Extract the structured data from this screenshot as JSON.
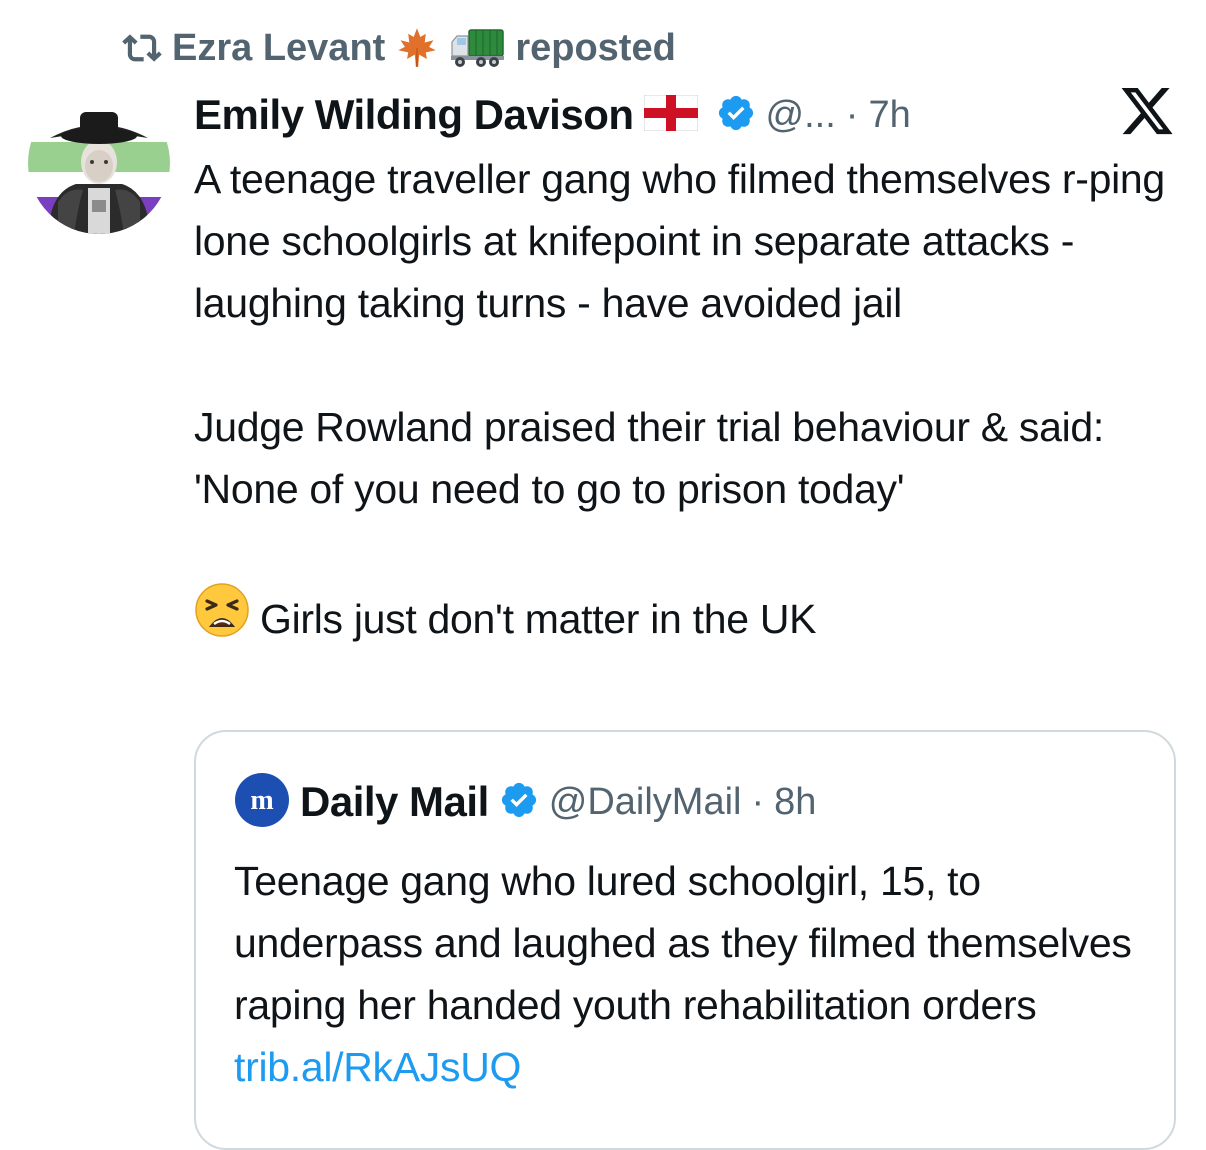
{
  "repost": {
    "user": "Ezra Levant",
    "action": "reposted",
    "icons": [
      "repost-icon",
      "maple-leaf-emoji",
      "truck-emoji"
    ]
  },
  "post": {
    "display_name": "Emily Wilding Davison",
    "name_emoji": "england-flag-emoji",
    "handle": "@...",
    "separator": "·",
    "time": "7h",
    "paragraphs": [
      "A teenage traveller gang who filmed themselves r-ping lone schoolgirls at knifepoint in separate attacks - laughing taking turns - have avoided jail",
      "Judge Rowland praised their trial behaviour & said: 'None of you need to go to prison today'"
    ],
    "closing_line": "Girls just don't matter in the UK",
    "closing_emoji": "tired-face-emoji"
  },
  "quote": {
    "display_name": "Daily Mail",
    "handle": "@DailyMail",
    "separator": "·",
    "time": "8h",
    "text": "Teenage gang who lured schoolgirl, 15, to underpass and laughed as they filmed themselves raping her handed youth rehabilitation orders",
    "link": "trib.al/RkAJsUQ"
  },
  "colors": {
    "text": "#0f1419",
    "secondary": "#536471",
    "link": "#1d9bf0",
    "verified": "#1d9bf0",
    "border": "#cfd9de",
    "daily_mail_blue": "#1d4fb2"
  }
}
